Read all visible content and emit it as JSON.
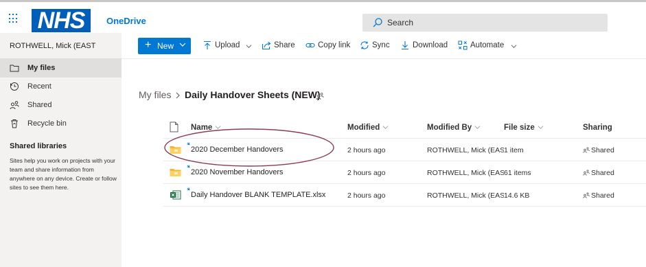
{
  "header": {
    "brand_logo": "NHS",
    "app_name": "OneDrive",
    "search_placeholder": "Search"
  },
  "sidebar": {
    "user_name": "ROTHWELL, Mick (EAST",
    "items": [
      {
        "label": "My files",
        "icon": "folder-icon",
        "active": true
      },
      {
        "label": "Recent",
        "icon": "clock-icon"
      },
      {
        "label": "Shared",
        "icon": "people-icon"
      },
      {
        "label": "Recycle bin",
        "icon": "trash-icon"
      }
    ],
    "shared_libraries_title": "Shared libraries",
    "shared_libraries_desc": "Sites help you work on projects with your team and share information from anywhere on any device. Create or follow sites to see them here."
  },
  "toolbar": {
    "new_label": "New",
    "upload_label": "Upload",
    "share_label": "Share",
    "copy_link_label": "Copy link",
    "sync_label": "Sync",
    "download_label": "Download",
    "automate_label": "Automate"
  },
  "breadcrumb": {
    "root": "My files",
    "current": "Daily Handover Sheets (NEW)"
  },
  "table": {
    "columns": {
      "name": "Name",
      "modified": "Modified",
      "modified_by": "Modified By",
      "file_size": "File size",
      "sharing": "Sharing"
    },
    "rows": [
      {
        "name": "2020 December Handovers",
        "type": "folder",
        "modified": "2 hours ago",
        "modified_by": "ROTHWELL, Mick (EAST CH",
        "file_size": "1 item",
        "sharing": "Shared"
      },
      {
        "name": "2020 November Handovers",
        "type": "folder",
        "modified": "2 hours ago",
        "modified_by": "ROTHWELL, Mick (EAST CH",
        "file_size": "61 items",
        "sharing": "Shared"
      },
      {
        "name": "Daily Handover BLANK TEMPLATE.xlsx",
        "type": "excel",
        "modified": "2 hours ago",
        "modified_by": "ROTHWELL, Mick (EAST CH",
        "file_size": "14.6 KB",
        "sharing": "Shared"
      }
    ]
  },
  "colors": {
    "accent": "#0078d4",
    "nhs_blue": "#005eb8",
    "annotation": "#8b3a5a",
    "folder": "#f3b43a",
    "excel": "#1e7145"
  }
}
